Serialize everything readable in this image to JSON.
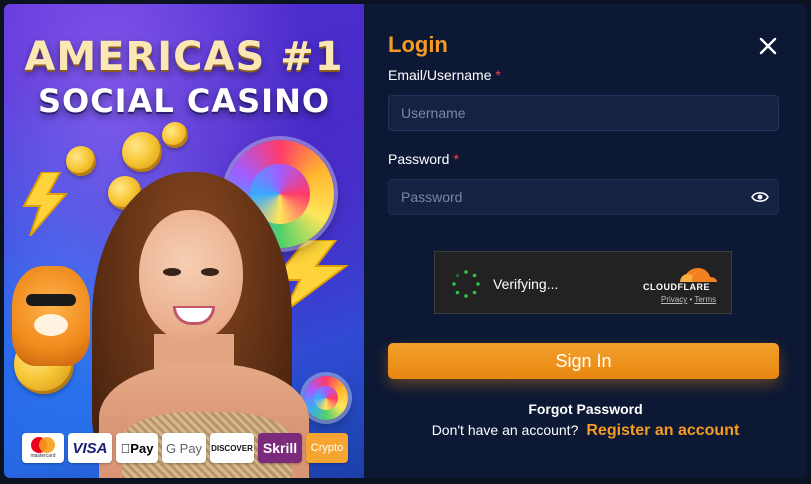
{
  "promo": {
    "headline_line1": "AMERICAS #1",
    "headline_line2": "SOCIAL CASINO",
    "payment_methods": {
      "mastercard": "mastercard",
      "visa": "VISA",
      "apple_pay": "Pay",
      "google_pay": "G Pay",
      "discover": "DISCOVER",
      "skrill": "Skrill",
      "crypto": "Crypto"
    }
  },
  "login": {
    "title": "Login",
    "email_label": "Email/Username",
    "password_label": "Password",
    "required_marker": "*",
    "username_placeholder": "Username",
    "password_placeholder": "Password",
    "captcha": {
      "status_text": "Verifying...",
      "brand": "CLOUDFLARE",
      "privacy_link": "Privacy",
      "separator": "•",
      "terms_link": "Terms"
    },
    "signin_label": "Sign In",
    "forgot_password": "Forgot Password",
    "no_account_text": "Don't have an account?",
    "register_link": "Register an account"
  },
  "colors": {
    "accent_orange": "#f59b22",
    "modal_bg": "#0c1834",
    "input_bg": "#142244",
    "required_red": "#ef4444"
  },
  "icons": [
    "close-icon",
    "eye-icon",
    "spinner-icon",
    "cloudflare-logo-icon"
  ]
}
